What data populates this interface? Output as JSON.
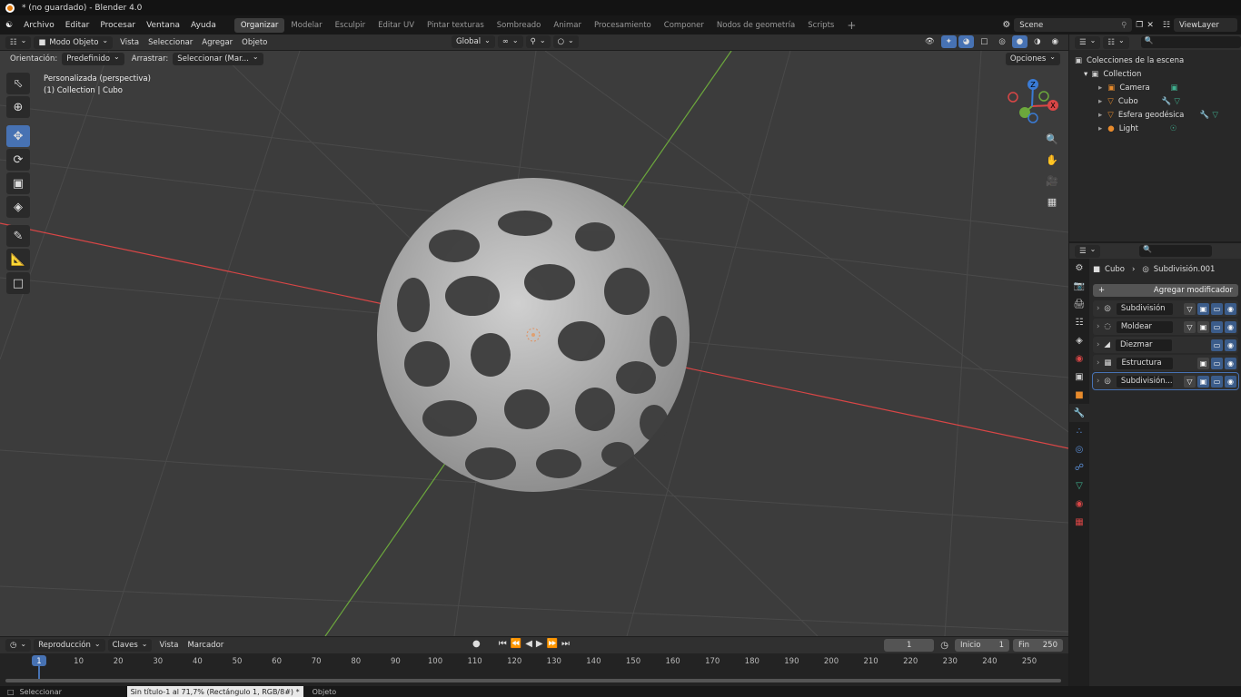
{
  "window": {
    "title": "* (no guardado) - Blender 4.0"
  },
  "menu": [
    "Archivo",
    "Editar",
    "Procesar",
    "Ventana",
    "Ayuda"
  ],
  "workspaces": [
    "Organizar",
    "Modelar",
    "Esculpir",
    "Editar UV",
    "Pintar texturas",
    "Sombreado",
    "Animar",
    "Procesamiento",
    "Componer",
    "Nodos de geometría",
    "Scripts"
  ],
  "active_workspace": "Organizar",
  "scene": {
    "name": "Scene",
    "view_layer": "ViewLayer"
  },
  "viewport_header": {
    "mode": "Modo Objeto",
    "menus": [
      "Vista",
      "Seleccionar",
      "Agregar",
      "Objeto"
    ],
    "transform": "Global"
  },
  "tool_settings": {
    "orientation_label": "Orientación:",
    "orientation_value": "Predefinido",
    "drag_label": "Arrastrar:",
    "drag_value": "Seleccionar (Mar...",
    "options": "Opciones"
  },
  "viewport_info": {
    "line1": "Personalizada (perspectiva)",
    "line2": "(1) Collection | Cubo"
  },
  "gizmo": {
    "x": "X",
    "y": "Y",
    "z": "Z"
  },
  "outliner": {
    "root": "Colecciones de la escena",
    "collection": "Collection",
    "items": [
      {
        "name": "Camera",
        "color": "#e88b2c"
      },
      {
        "name": "Cubo",
        "color": "#e88b2c"
      },
      {
        "name": "Esfera geodésica",
        "color": "#e88b2c"
      },
      {
        "name": "Light",
        "color": "#e88b2c"
      }
    ]
  },
  "properties": {
    "object": "Cubo",
    "modifier_path": "Subdivisión.001",
    "add_modifier": "Agregar modificador",
    "modifiers": [
      "Subdivisión",
      "Moldear",
      "Diezmar",
      "Estructura",
      "Subdivisión...."
    ]
  },
  "timeline": {
    "menus": [
      "Reproducción",
      "Claves",
      "Vista",
      "Marcador"
    ],
    "current_frame": "1",
    "start_label": "Inicio",
    "start": "1",
    "end_label": "Fin",
    "end": "250",
    "ticks": [
      "1",
      "10",
      "20",
      "30",
      "40",
      "50",
      "60",
      "70",
      "80",
      "90",
      "100",
      "110",
      "120",
      "130",
      "140",
      "150",
      "160",
      "170",
      "180",
      "190",
      "200",
      "210",
      "220",
      "230",
      "240",
      "250"
    ]
  },
  "statusbar": {
    "left": "Seleccionar",
    "tooltip": "Sin título-1 al 71,7% (Rectángulo 1, RGB/8#) *",
    "right": "Objeto"
  },
  "colors": {
    "accent": "#4772b3",
    "x_axis": "#d94646",
    "y_axis": "#6ca83c",
    "mesh": "#b9b9b9"
  }
}
